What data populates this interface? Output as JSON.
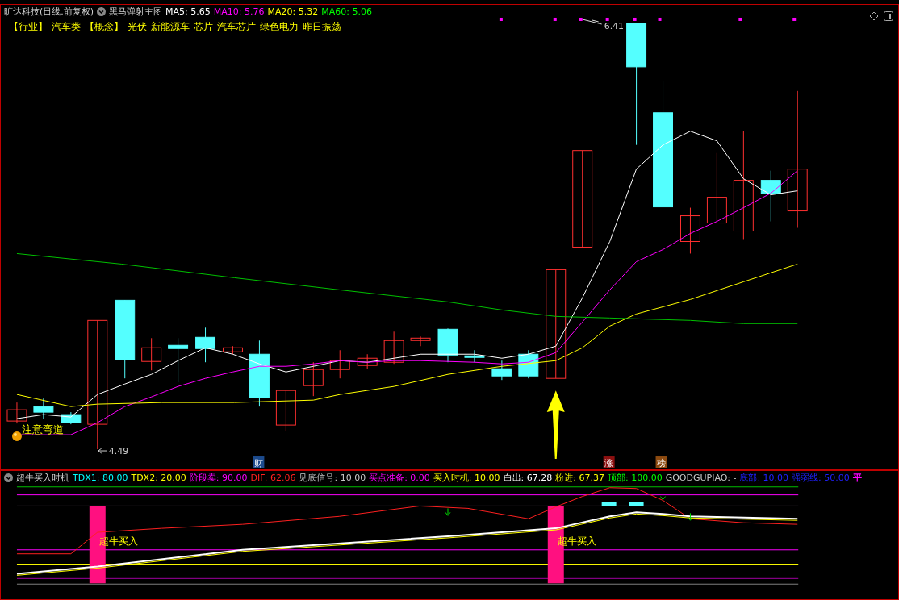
{
  "header": {
    "stock_name": "旷达科技(日线.前复权)",
    "indicator": "黑马弹射主图",
    "averages": [
      {
        "label": "MA5: 5.65",
        "color": "#ffffff"
      },
      {
        "label": "MA10: 5.76",
        "color": "#ff00ff"
      },
      {
        "label": "MA20: 5.32",
        "color": "#ffff00"
      },
      {
        "label": "MA60: 5.06",
        "color": "#00ff00"
      }
    ]
  },
  "tags": [
    "【行业】",
    "汽车类",
    "【概念】",
    "光伏",
    "新能源车",
    "芯片",
    "汽车芯片",
    "绿色电力",
    "昨日振荡"
  ],
  "annotations": {
    "warning": "注意弯道",
    "low": "4.49",
    "high": "6.41"
  },
  "badges": [
    {
      "text": "财",
      "color": "#1c4a8c"
    },
    {
      "text": "涨",
      "color": "#8c1010"
    },
    {
      "text": "榜",
      "color": "#8c4a10"
    }
  ],
  "sub_panel": {
    "title": "超牛买入时机",
    "indicators": [
      {
        "label": "TDX1: 80.00",
        "color": "#00ffff"
      },
      {
        "label": "TDX2: 20.00",
        "color": "#ffff00"
      },
      {
        "label": "阶段卖: 90.00",
        "color": "#ff00ff"
      },
      {
        "label": "DIF: 62.06",
        "color": "#ff2020"
      },
      {
        "label": "见底信号: 10.00",
        "color": "#c8c8c8"
      },
      {
        "label": "买点准备: 0.00",
        "color": "#ff00ff"
      },
      {
        "label": "买入时机: 10.00",
        "color": "#ffff00"
      },
      {
        "label": "白出: 67.28",
        "color": "#ffffff"
      },
      {
        "label": "粉进: 67.37",
        "color": "#ffff00"
      },
      {
        "label": "顶部: 100.00",
        "color": "#00ff00"
      },
      {
        "label": "GOODGUPIAO: -",
        "color": "#c8c8c8"
      },
      {
        "label": "底部: 10.00",
        "color": "#2020ff"
      },
      {
        "label": "强弱线: 50.00",
        "color": "#2020ff"
      },
      {
        "label": "平",
        "color": "#ff00ff"
      }
    ],
    "signals": [
      "超牛买入",
      "超牛买入"
    ]
  }
}
